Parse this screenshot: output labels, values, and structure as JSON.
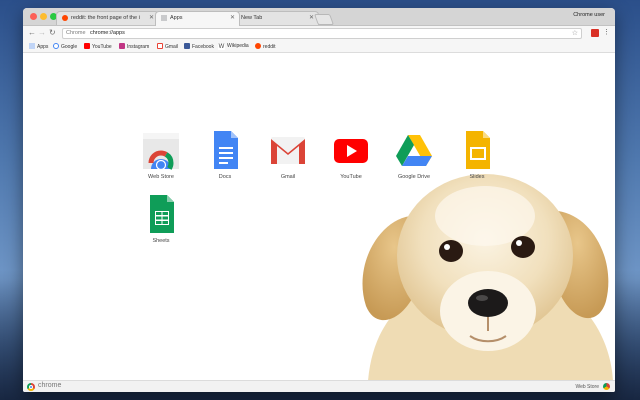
{
  "browser": {
    "profile_name": "Chrome user",
    "tabs": [
      {
        "title": "reddit: the front page of the i",
        "favicon": "reddit-icon",
        "active": false
      },
      {
        "title": "Apps",
        "favicon": "apps-grid-icon",
        "active": true
      },
      {
        "title": "New Tab",
        "favicon": "",
        "active": false
      }
    ],
    "omnibox": {
      "scheme": "Chrome",
      "url": "chrome://apps"
    },
    "bookmarks": [
      {
        "label": "Apps",
        "icon": "apps-grid-icon",
        "color": "#4285f4"
      },
      {
        "label": "Google",
        "icon": "google-icon",
        "color": "#4285f4"
      },
      {
        "label": "YouTube",
        "icon": "youtube-icon",
        "color": "#ff0000"
      },
      {
        "label": "Instagram",
        "icon": "instagram-icon",
        "color": "#c13584"
      },
      {
        "label": "Gmail",
        "icon": "gmail-icon",
        "color": "#ea4335"
      },
      {
        "label": "Facebook",
        "icon": "facebook-icon",
        "color": "#3b5998"
      },
      {
        "label": "Wikipedia",
        "icon": "wikipedia-icon",
        "color": "#444444"
      },
      {
        "label": "reddit",
        "icon": "reddit-icon",
        "color": "#ff4500"
      }
    ]
  },
  "apps": [
    {
      "label": "Web Store",
      "icon": "chrome-web-store-icon"
    },
    {
      "label": "Docs",
      "icon": "google-docs-icon"
    },
    {
      "label": "Gmail",
      "icon": "gmail-icon"
    },
    {
      "label": "YouTube",
      "icon": "youtube-icon"
    },
    {
      "label": "Google Drive",
      "icon": "google-drive-icon"
    },
    {
      "label": "Slides",
      "icon": "google-slides-icon"
    },
    {
      "label": "Sheets",
      "icon": "google-sheets-icon"
    }
  ],
  "footer": {
    "brand": "chrome",
    "store_link": "Web Store"
  },
  "colors": {
    "accent_blue": "#4285f4",
    "accent_red": "#db4437",
    "accent_yellow": "#f4b400",
    "accent_green": "#0f9d58"
  }
}
